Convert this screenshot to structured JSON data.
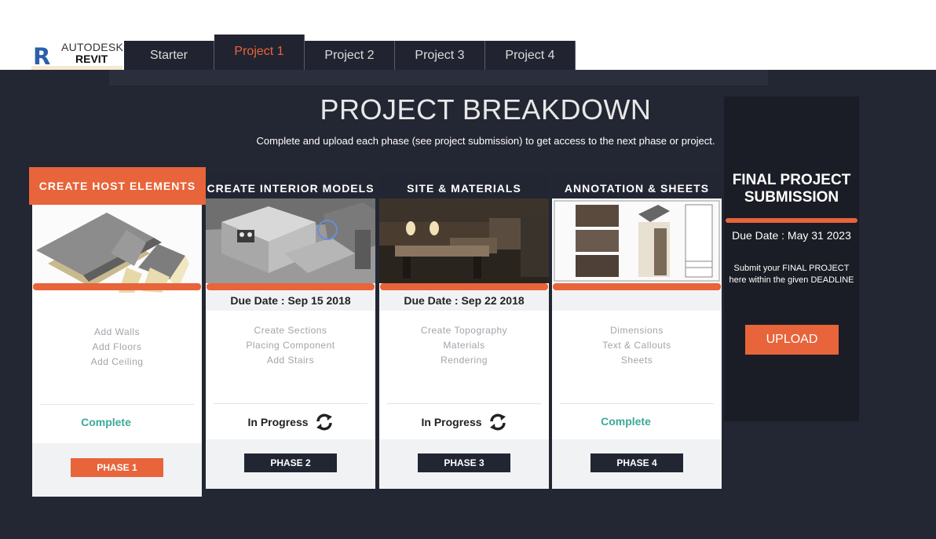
{
  "logo": {
    "letter": "R",
    "line1": "AUTODESK",
    "line2": "REVIT"
  },
  "tabs": [
    {
      "label": "Starter"
    },
    {
      "label": "Project 1"
    },
    {
      "label": "Project 2"
    },
    {
      "label": "Project 3"
    },
    {
      "label": "Project 4"
    }
  ],
  "active_tab": "Project 1",
  "page": {
    "title": "PROJECT BREAKDOWN",
    "subtitle": "Complete and upload each phase (see project submission) to get access to the next phase or project."
  },
  "cards": [
    {
      "title": "CREATE HOST ELEMENTS",
      "due": "",
      "tasks": [
        "Add Walls",
        "Add Floors",
        "Add Ceiling"
      ],
      "status": "Complete",
      "phase": "PHASE 1"
    },
    {
      "title": "CREATE INTERIOR MODELS",
      "due": "Due Date : Sep 15 2018",
      "tasks": [
        "Create Sections",
        "Placing Component",
        "Add Stairs"
      ],
      "status": "In Progress",
      "phase": "PHASE 2"
    },
    {
      "title": "SITE & MATERIALS",
      "due": "Due Date : Sep 22 2018",
      "tasks": [
        "Create Topography",
        "Materials",
        "Rendering"
      ],
      "status": "In Progress",
      "phase": "PHASE 3"
    },
    {
      "title": "ANNOTATION & SHEETS",
      "due": "",
      "tasks": [
        "Dimensions",
        "Text & Callouts",
        "Sheets"
      ],
      "status": "Complete",
      "phase": "PHASE 4"
    }
  ],
  "final": {
    "title_line1": "FINAL PROJECT",
    "title_line2": "SUBMISSION",
    "due": "Due Date : May 31 2023",
    "text_line1": "Submit your FINAL PROJECT",
    "text_line2": "here within the given DEADLINE",
    "button": "UPLOAD"
  },
  "colors": {
    "accent": "#e8643a",
    "dark": "#232633",
    "complete": "#3aaa9a"
  },
  "icons": {
    "progress": "refresh-icon"
  }
}
